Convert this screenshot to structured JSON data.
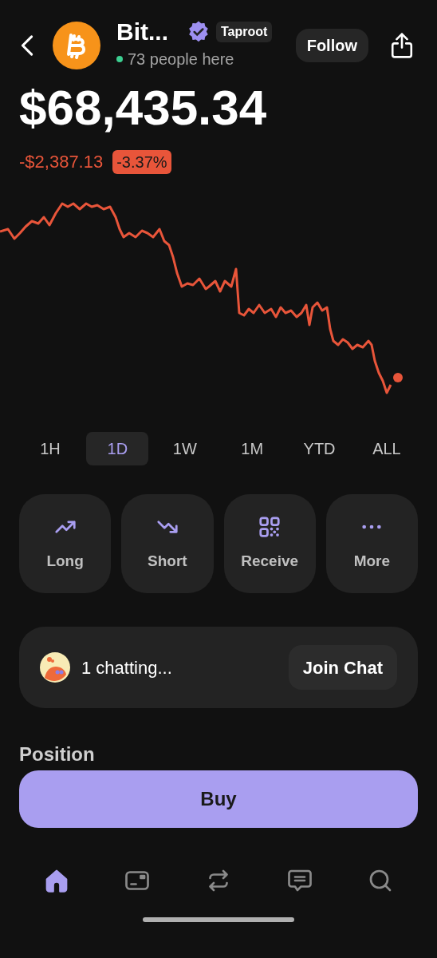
{
  "header": {
    "name": "Bit...",
    "badge": "Taproot",
    "verified": true,
    "presence": "73 people here",
    "follow": "Follow"
  },
  "price": {
    "value": "$68,435.34",
    "change": "-$2,387.13",
    "percent": "-3.37%"
  },
  "ranges": [
    {
      "label": "1H",
      "selected": false
    },
    {
      "label": "1D",
      "selected": true
    },
    {
      "label": "1W",
      "selected": false
    },
    {
      "label": "1M",
      "selected": false
    },
    {
      "label": "YTD",
      "selected": false
    },
    {
      "label": "ALL",
      "selected": false
    }
  ],
  "actions": [
    {
      "kind": "long",
      "label": "Long"
    },
    {
      "kind": "short",
      "label": "Short"
    },
    {
      "kind": "receive",
      "label": "Receive"
    },
    {
      "kind": "more",
      "label": "More"
    }
  ],
  "chat": {
    "text": "1 chatting...",
    "button": "Join Chat"
  },
  "position": {
    "title": "Position",
    "button": "Buy"
  },
  "nav": [
    {
      "kind": "home",
      "selected": true
    },
    {
      "kind": "card",
      "selected": false
    },
    {
      "kind": "swap",
      "selected": false
    },
    {
      "kind": "chat",
      "selected": false
    },
    {
      "kind": "search",
      "selected": false
    }
  ]
}
